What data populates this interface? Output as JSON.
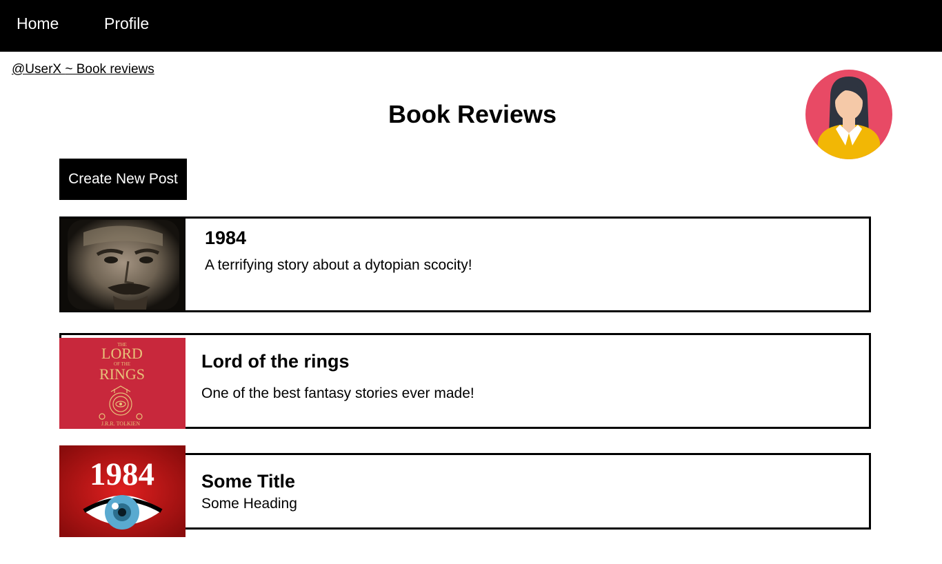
{
  "nav": {
    "home_label": "Home",
    "profile_label": "Profile"
  },
  "breadcrumb": {
    "user": "@UserX ",
    "separator": "~",
    "section": " Book reviews"
  },
  "page": {
    "title": "Book Reviews"
  },
  "actions": {
    "create_label": "Create New Post"
  },
  "posts": [
    {
      "title": "1984",
      "description": "A terrifying story about a dytopian scocity!",
      "thumbnail": "big-brother-face-image"
    },
    {
      "title": "Lord of the rings",
      "description": "One of the best fantasy stories ever made!",
      "thumbnail": "lord-of-the-rings-cover",
      "cover_text": {
        "top": "THE",
        "main1": "LORD",
        "middle": "OF THE",
        "main2": "RINGS",
        "author": "J.R.R. TOLKIEN"
      }
    },
    {
      "title": "Some Title",
      "description": "Some Heading",
      "thumbnail": "1984-eye-cover",
      "cover_text": {
        "year": "1984"
      }
    }
  ],
  "colors": {
    "nav_bg": "#000000",
    "avatar_bg": "#e84a65",
    "avatar_shirt": "#f2b705",
    "lotr_cover": "#c8283c",
    "lotr_gold": "#e8c27a",
    "eye_cover": "#b81414",
    "eye_iris": "#5aaad0"
  }
}
